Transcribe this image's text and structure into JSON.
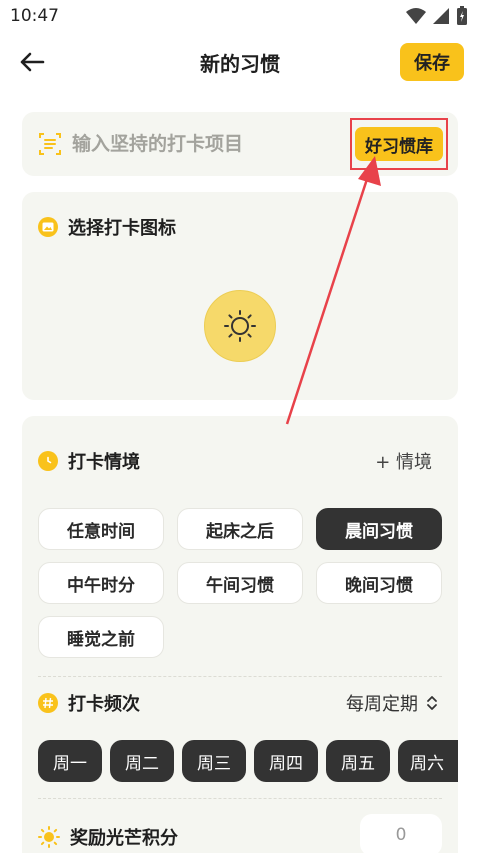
{
  "status_bar": {
    "time": "10:47"
  },
  "header": {
    "title": "新的习惯",
    "save_label": "保存"
  },
  "habit_input": {
    "placeholder": "输入坚持的打卡项目",
    "library_label": "好习惯库"
  },
  "icon_section": {
    "title": "选择打卡图标"
  },
  "scenario_section": {
    "title": "打卡情境",
    "add_label": "+ 情境",
    "options": [
      "任意时间",
      "起床之后",
      "晨间习惯",
      "中午时分",
      "午间习惯",
      "晚间习惯",
      "睡觉之前"
    ],
    "selected": "晨间习惯"
  },
  "frequency_section": {
    "title": "打卡频次",
    "mode": "每周定期",
    "days": [
      "周一",
      "周二",
      "周三",
      "周四",
      "周五",
      "周六"
    ]
  },
  "reward_section": {
    "title": "奖励光芒积分",
    "value": "0"
  },
  "colors": {
    "accent": "#f9c21b",
    "highlight_box": "#e8424a",
    "selected_chip": "#333333"
  }
}
